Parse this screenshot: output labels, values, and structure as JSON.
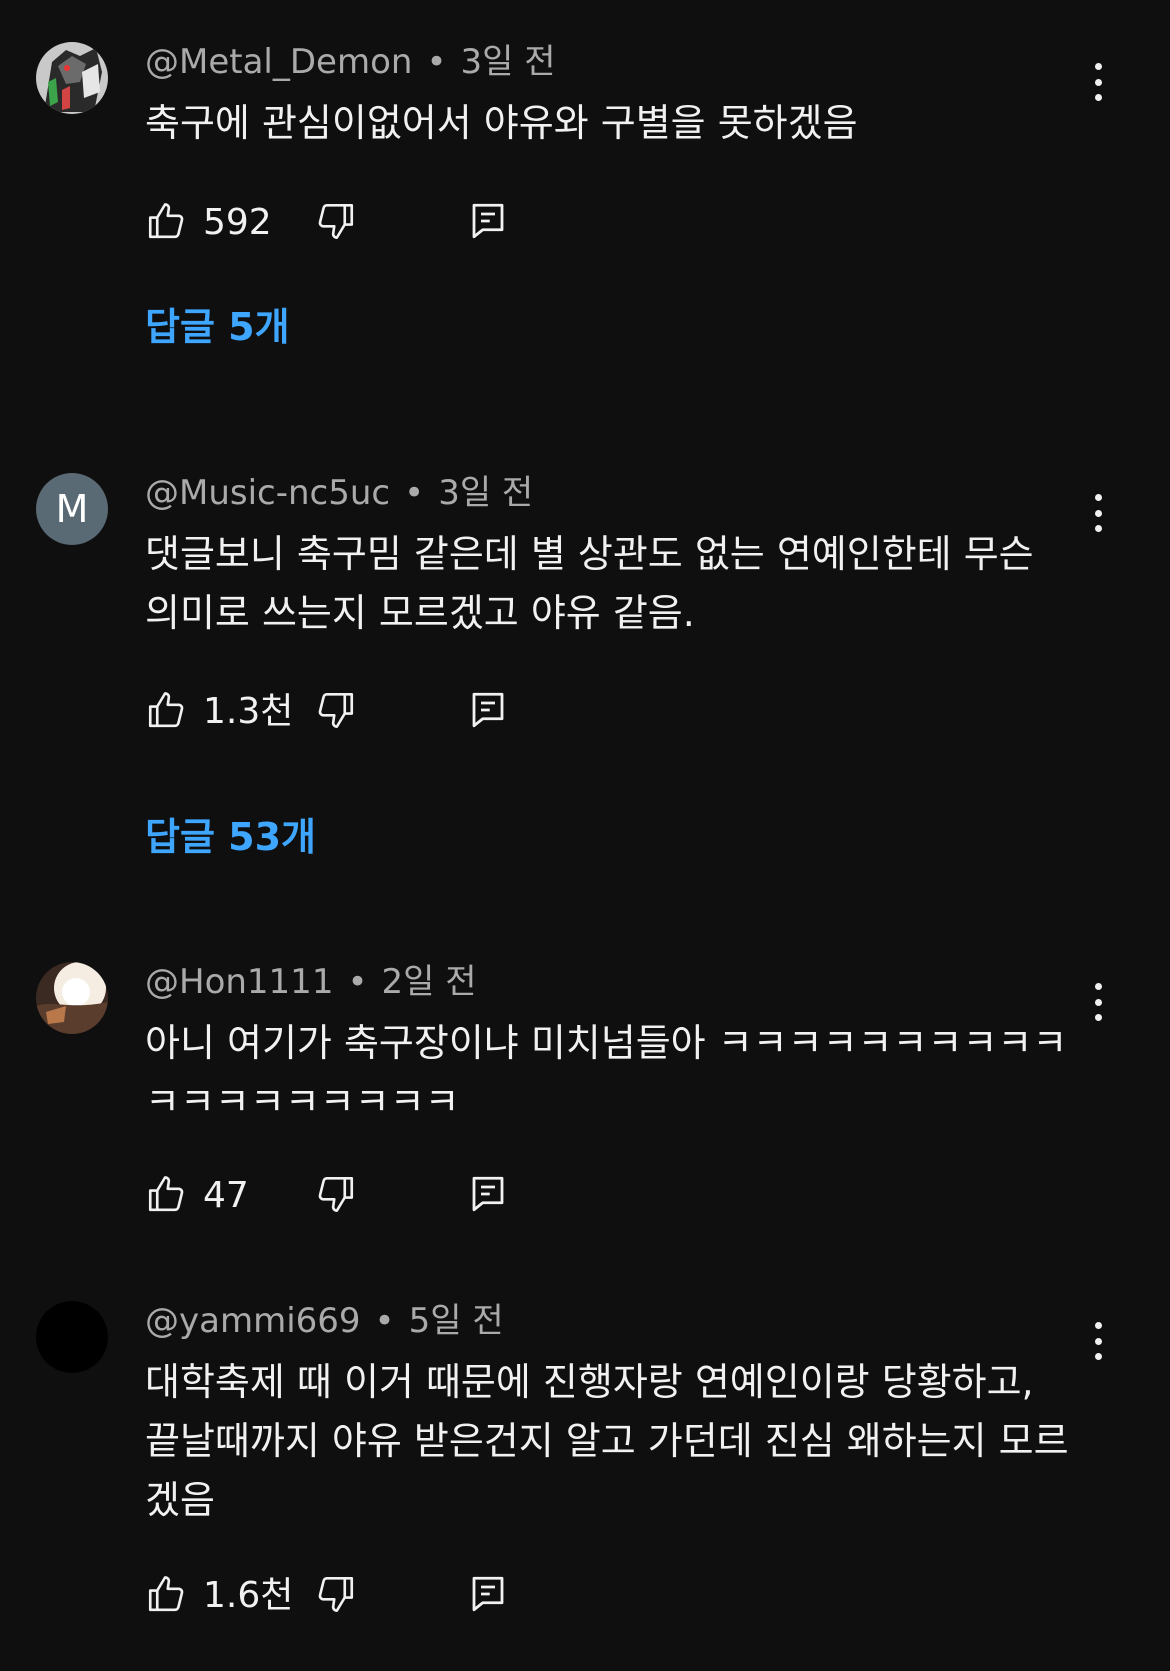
{
  "comments": [
    {
      "author": "@Metal_Demon",
      "time": "3일 전",
      "text": "축구에 관심이없어서 야유와 구별을 못하겠음",
      "likes": "592",
      "replies_label": "답글 5개"
    },
    {
      "author": "@Music-nc5uc",
      "avatar_letter": "M",
      "time": "3일 전",
      "text": "댓글보니 축구밈 같은데 별 상관도 없는 연예인한테 무슨 의미로 쓰는지 모르겠고 야유 같음.",
      "likes": "1.3천",
      "replies_label": "답글 53개"
    },
    {
      "author": "@Hon1111",
      "time": "2일 전",
      "text": "아니 여기가 축구장이냐 미치넘들아 ㅋㅋㅋㅋㅋㅋㅋㅋㅋㅋㅋㅋㅋㅋㅋㅋㅋㅋㅋ",
      "likes": "47"
    },
    {
      "author": "@yammi669",
      "time": "5일 전",
      "text": "대학축제 때 이거 때문에 진행자랑 연예인이랑 당황하고, 끝날때까지 야유 받은건지 알고 가던데 진심 왜하는지 모르겠음",
      "likes": "1.6천"
    }
  ],
  "meta_separator": "•",
  "colors": {
    "background": "#0f0f0f",
    "link": "#3ea6ff",
    "secondary": "#aaaaaa"
  },
  "icons": [
    "like-icon",
    "dislike-icon",
    "reply-icon",
    "more-options-icon"
  ]
}
